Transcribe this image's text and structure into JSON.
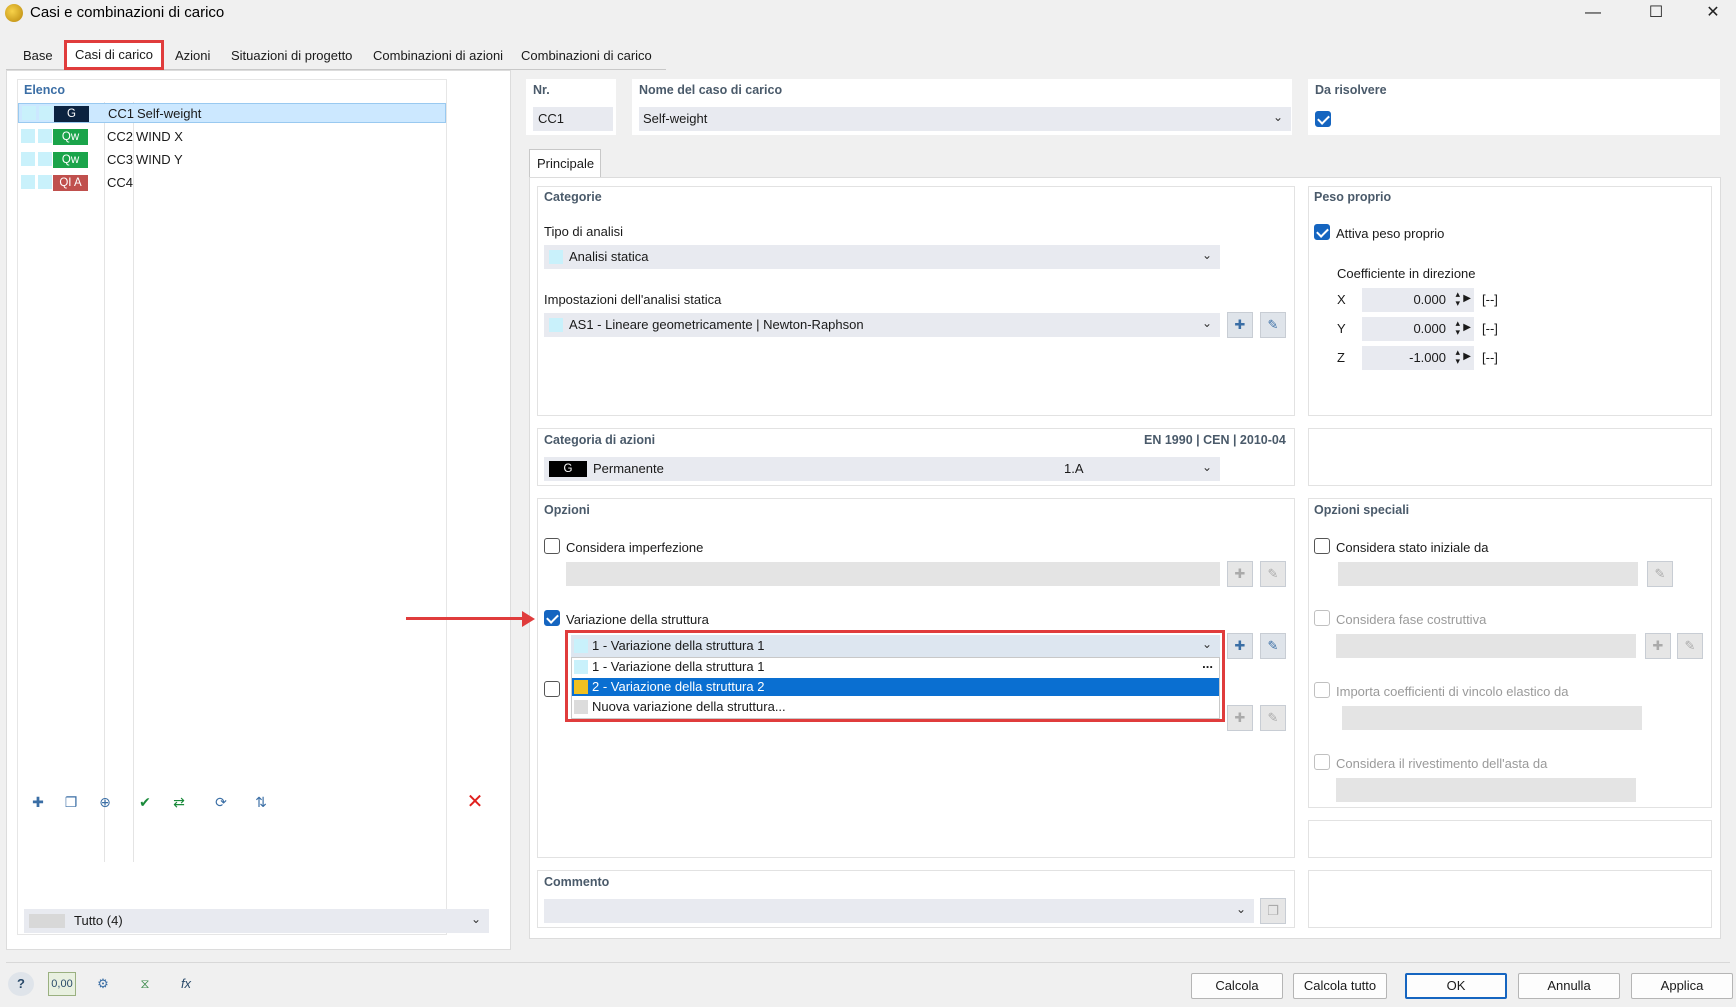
{
  "window": {
    "title": "Casi e combinazioni di carico"
  },
  "tabs": [
    "Base",
    "Casi di carico",
    "Azioni",
    "Situazioni di progetto",
    "Combinazioni di azioni",
    "Combinazioni di carico"
  ],
  "list": {
    "header": "Elenco",
    "items": [
      {
        "badge": "G",
        "badge_color": "#0b2340",
        "id": "CC1",
        "name": "Self-weight"
      },
      {
        "badge": "Qw",
        "badge_color": "#1aa44a",
        "id": "CC2",
        "name": "WIND X"
      },
      {
        "badge": "Qw",
        "badge_color": "#1aa44a",
        "id": "CC3",
        "name": "WIND Y"
      },
      {
        "badge": "QI A",
        "badge_color": "#c0504d",
        "id": "CC4",
        "name": ""
      }
    ],
    "filter": "Tutto (4)"
  },
  "header_fields": {
    "nr_label": "Nr.",
    "nr_value": "CC1",
    "name_label": "Nome del caso di carico",
    "name_value": "Self-weight",
    "solve_label": "Da risolvere"
  },
  "subtab": "Principale",
  "categorie": {
    "header": "Categorie",
    "tipo_label": "Tipo di analisi",
    "tipo_value": "Analisi statica",
    "impost_label": "Impostazioni dell'analisi statica",
    "impost_value": "AS1 - Lineare geometricamente | Newton-Raphson"
  },
  "peso": {
    "header": "Peso proprio",
    "attiva": "Attiva peso proprio",
    "coeff_label": "Coefficiente in direzione",
    "rows": [
      {
        "axis": "X",
        "value": "0.000",
        "unit": "[--]"
      },
      {
        "axis": "Y",
        "value": "0.000",
        "unit": "[--]"
      },
      {
        "axis": "Z",
        "value": "-1.000",
        "unit": "[--]"
      }
    ]
  },
  "azioni": {
    "header": "Categoria di azioni",
    "norm": "EN 1990 | CEN | 2010-04",
    "badge": "G",
    "value": "Permanente",
    "code": "1.A"
  },
  "opzioni": {
    "header": "Opzioni",
    "imperf": "Considera imperfezione",
    "variazione": "Variazione della struttura",
    "dd_selected": "1 - Variazione della struttura 1",
    "dd_items": [
      "1 - Variazione della struttura 1",
      "2 - Variazione della struttura 2",
      "Nuova variazione della struttura..."
    ],
    "dd_more": "..."
  },
  "speciali": {
    "header": "Opzioni speciali",
    "stato": "Considera stato iniziale da",
    "fase": "Considera fase costruttiva",
    "vincolo": "Importa coefficienti di vincolo elastico da",
    "rivest": "Considera il rivestimento dell'asta da"
  },
  "commento": {
    "header": "Commento"
  },
  "buttons": {
    "calcola": "Calcola",
    "calcola_tutto": "Calcola tutto",
    "ok": "OK",
    "annulla": "Annulla",
    "applica": "Applica"
  },
  "status_value": "0,00"
}
